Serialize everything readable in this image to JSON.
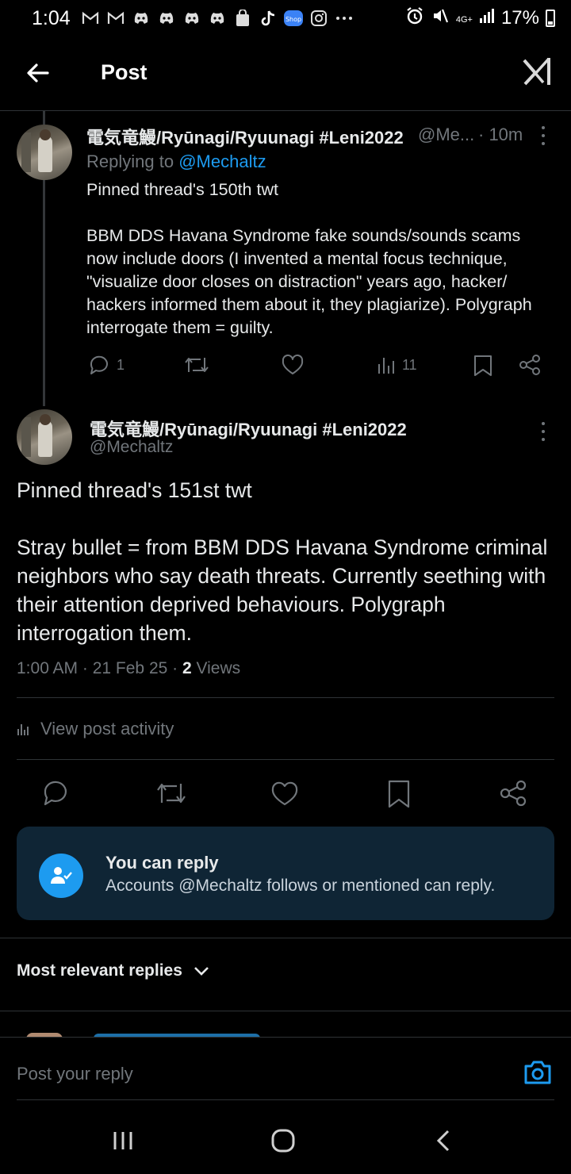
{
  "status_bar": {
    "time": "1:04",
    "network": "4G+",
    "battery": "17%"
  },
  "header": {
    "title": "Post"
  },
  "parent_post": {
    "display_name": "電気竜鰻/Ryūnagi/Ryuunagi #Leni2022",
    "handle": "@Me...",
    "time": "· 10m",
    "replying_prefix": "Replying to",
    "replying_to": "@Mechaltz",
    "text": "Pinned thread's 150th twt\n\nBBM DDS Havana Syndrome fake sounds/sounds scams now include doors (I invented a mental focus technique, \"visualize door closes on distraction\" years ago, hacker/ hackers informed them about it, they plagiarize). Polygraph interrogate them = guilty.",
    "reply_count": "1",
    "view_count": "11"
  },
  "main_post": {
    "display_name": "電気竜鰻/Ryūnagi/Ryuunagi #Leni2022",
    "handle": "@Mechaltz",
    "text": "Pinned thread's 151st twt\n\nStray bullet = from BBM DDS Havana Syndrome criminal neighbors who say death threats. Currently seething with their attention deprived behaviours. Polygraph interrogation them.",
    "time": "1:00 AM",
    "date": "21 Feb 25",
    "views_count": "2",
    "views_label": "Views",
    "view_activity": "View post activity"
  },
  "reply_card": {
    "title": "You can reply",
    "subtitle": "Accounts @Mechaltz follows or mentioned can reply."
  },
  "replies_sort": {
    "label": "Most relevant replies"
  },
  "reply_bar": {
    "placeholder": "Post your reply"
  },
  "colors": {
    "accent": "#1d9bf0",
    "muted": "#71767b",
    "card_bg": "#0f2535"
  }
}
